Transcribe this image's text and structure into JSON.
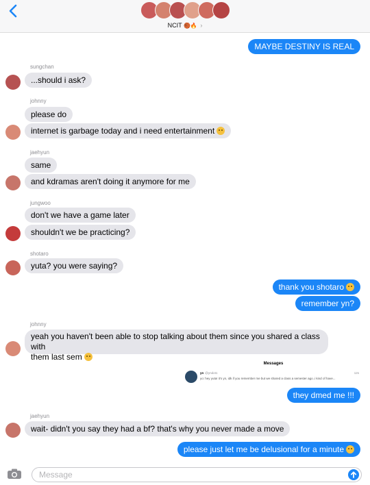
{
  "header": {
    "group_name": "NCIT",
    "group_emoji": "🏀🔥",
    "chevron": "›",
    "avatar_colors": [
      "#c95b5b",
      "#d4826e",
      "#b95050",
      "#e0a08a",
      "#cf6b5f",
      "#b54444"
    ]
  },
  "messages": {
    "m1": "MAYBE DESTINY IS REAL",
    "m2_sender": "sungchan",
    "m2": "...should i ask?",
    "m3_sender": "johnny",
    "m3": "please do",
    "m4": "internet is garbage today and i need entertainment",
    "m5_sender": "jaehyun",
    "m5": "same",
    "m6": "and kdramas aren't doing it anymore for me",
    "m7_sender": "jungwoo",
    "m7": "don't we have a game later",
    "m8": "shouldn't we be practicing?",
    "m9_sender": "shotaro",
    "m9": "yuta? you were saying?",
    "m10": "thank you shotaro",
    "m11": "remember yn?",
    "m12_sender": "johnny",
    "m12_line1": "yeah you haven't been able to stop talking about them since you shared a class with",
    "m12_line2": "them last sem",
    "m13": "they dmed me !!!",
    "m14_sender": "jaehyun",
    "m14": "wait- didn't you say they had a bf? that's why you never made a move",
    "m15": "please just let me be delusional for a minute"
  },
  "screenshot": {
    "title": "Messages",
    "name": "yn",
    "handle": "@yndot1",
    "time": "12s",
    "text": "yo: hey yuta! it's yn, idk if you remember me but we shared a class a semester ago..i kind of have..."
  },
  "input": {
    "placeholder": "Message"
  },
  "colors": {
    "outgoing": "#1b86f7",
    "incoming": "#e5e5ea"
  }
}
